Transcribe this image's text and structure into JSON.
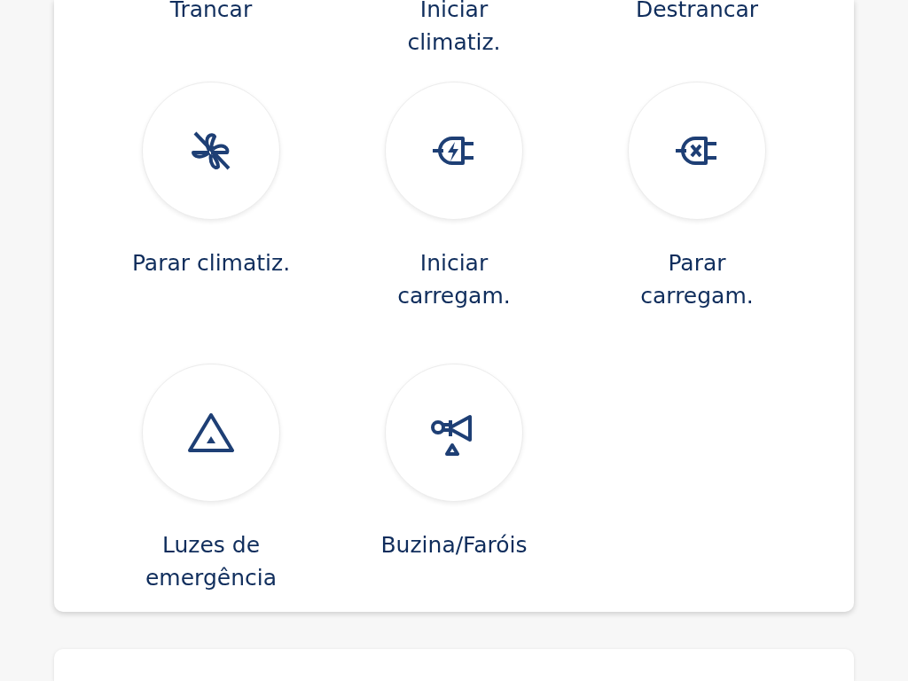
{
  "actions": [
    {
      "label": "Trancar"
    },
    {
      "label": "Iniciar climatiz."
    },
    {
      "label": "Destrancar"
    },
    {
      "label": "Parar climatiz.",
      "kind": "fan-off"
    },
    {
      "label": "Iniciar carregam.",
      "kind": "plug-charge"
    },
    {
      "label": "Parar carregam.",
      "kind": "plug-stop"
    },
    {
      "label": "Luzes de emergência",
      "kind": "hazard"
    },
    {
      "label": "Buzina/Faróis",
      "kind": "horn"
    }
  ]
}
